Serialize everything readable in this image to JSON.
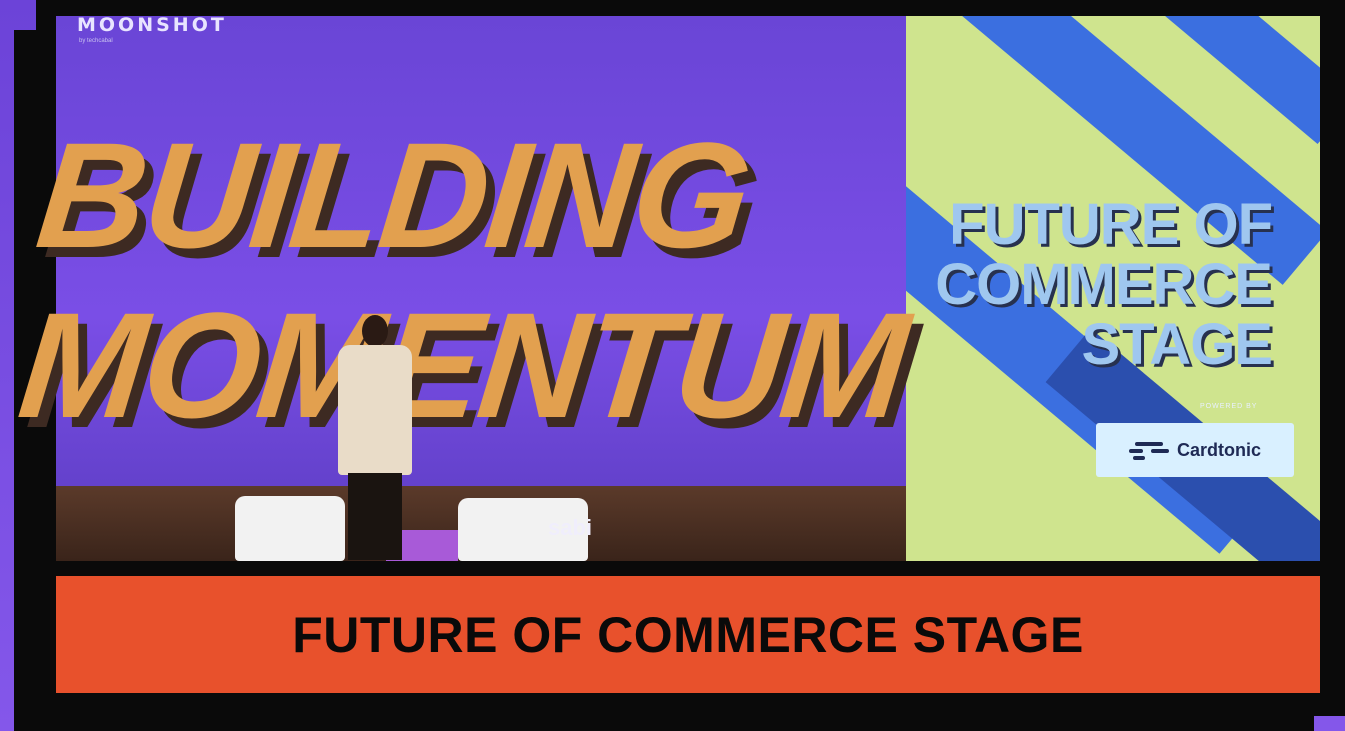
{
  "photo": {
    "screen_brand": "MOONSHOT",
    "screen_brand_sub": "by techcabal",
    "screen_title_lines": [
      "BUILDING",
      "MOMENTUM"
    ],
    "stage_sponsor": "sabi",
    "right_screen_title_lines": [
      "FUTURE OF",
      "COMMERCE",
      "STAGE"
    ],
    "powered_by": "POWERED BY",
    "sponsor_logo": "Cardtonic"
  },
  "banner": {
    "title": "FUTURE OF COMMERCE STAGE"
  },
  "colors": {
    "background": "#7a4fe0",
    "frame": "#0a0a0a",
    "banner": "#e8512c",
    "screen": "#6a45d6",
    "screen_title": "#e2a04f"
  }
}
